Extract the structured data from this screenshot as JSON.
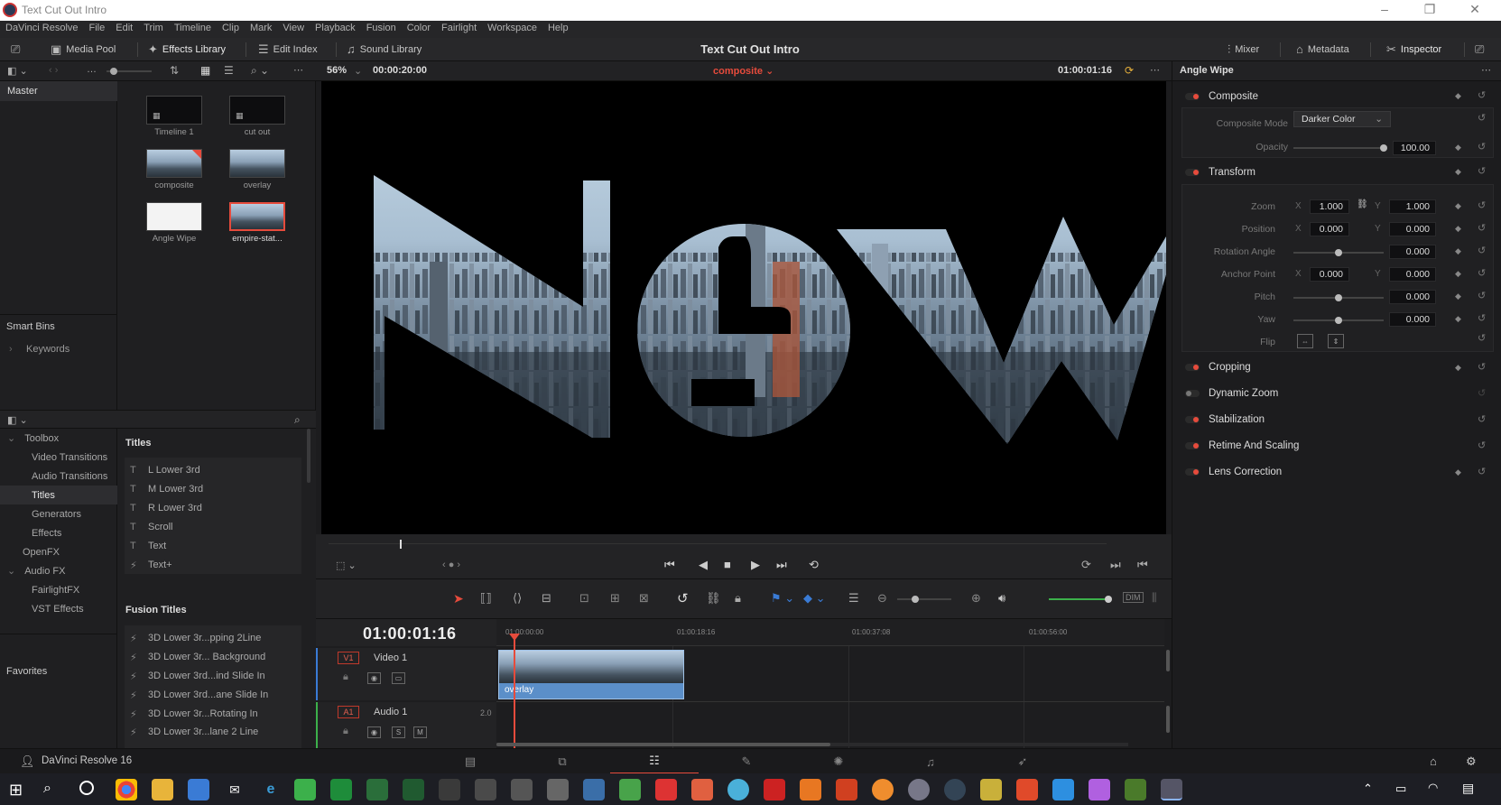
{
  "window": {
    "title": "Text Cut Out Intro"
  },
  "menu": [
    "DaVinci Resolve",
    "File",
    "Edit",
    "Trim",
    "Timeline",
    "Clip",
    "Mark",
    "View",
    "Playback",
    "Fusion",
    "Color",
    "Fairlight",
    "Workspace",
    "Help"
  ],
  "toolbar": {
    "media_pool": "Media Pool",
    "effects_library": "Effects Library",
    "edit_index": "Edit Index",
    "sound_library": "Sound Library",
    "project_title": "Text Cut Out Intro",
    "mixer": "Mixer",
    "metadata": "Metadata",
    "inspector": "Inspector"
  },
  "subbar": {
    "zoom": "56%",
    "duration": "00:00:20:00",
    "timeline_name": "composite",
    "timecode": "01:00:01:16",
    "inspector_title": "Angle Wipe"
  },
  "bins": {
    "master": "Master",
    "smart_bins": "Smart Bins",
    "keywords": "Keywords",
    "favorites": "Favorites"
  },
  "media": [
    {
      "label": "Timeline 1"
    },
    {
      "label": "cut out"
    },
    {
      "label": "composite"
    },
    {
      "label": "overlay"
    },
    {
      "label": "Angle Wipe"
    },
    {
      "label": "empire-stat..."
    }
  ],
  "toolbox": {
    "root": "Toolbox",
    "items": [
      "Video Transitions",
      "Audio Transitions",
      "Titles",
      "Generators",
      "Effects"
    ],
    "openfx": "OpenFX",
    "audiofx": "Audio FX",
    "audio_items": [
      "FairlightFX",
      "VST Effects"
    ]
  },
  "titles": {
    "header": "Titles",
    "items": [
      "L Lower 3rd",
      "M Lower 3rd",
      "R Lower 3rd",
      "Scroll",
      "Text",
      "Text+"
    ]
  },
  "fusion_titles": {
    "header": "Fusion Titles",
    "items": [
      "3D Lower 3r...pping 2Line",
      "3D Lower 3r... Background",
      "3D Lower 3rd...ind Slide In",
      "3D Lower 3rd...ane Slide In",
      "3D Lower 3r...Rotating In",
      "3D Lower 3r...lane 2 Line"
    ]
  },
  "viewer": {
    "text": "New"
  },
  "timeline": {
    "timecode": "01:00:01:16",
    "ruler": [
      "01:00:00:00",
      "01:00:18:16",
      "01:00:37:08",
      "01:00:56:00"
    ],
    "video_track": {
      "id": "V1",
      "name": "Video 1",
      "clip": "overlay"
    },
    "audio_track": {
      "id": "A1",
      "name": "Audio 1",
      "channels": "2.0",
      "solo": "S",
      "mute": "M"
    }
  },
  "inspector": {
    "composite": {
      "label": "Composite",
      "mode_label": "Composite Mode",
      "mode_value": "Darker Color",
      "opacity_label": "Opacity",
      "opacity_value": "100.00"
    },
    "transform": {
      "label": "Transform",
      "zoom_label": "Zoom",
      "zoom_x": "1.000",
      "zoom_y": "1.000",
      "position_label": "Position",
      "pos_x": "0.000",
      "pos_y": "0.000",
      "rotation_label": "Rotation Angle",
      "rotation": "0.000",
      "anchor_label": "Anchor Point",
      "anchor_x": "0.000",
      "anchor_y": "0.000",
      "pitch_label": "Pitch",
      "pitch": "0.000",
      "yaw_label": "Yaw",
      "yaw": "0.000",
      "flip_label": "Flip",
      "x": "X",
      "y": "Y"
    },
    "cropping": "Cropping",
    "dynamic_zoom": "Dynamic Zoom",
    "stabilization": "Stabilization",
    "retime": "Retime And Scaling",
    "lens": "Lens Correction"
  },
  "pagebar": {
    "app": "DaVinci Resolve 16"
  },
  "colors": {
    "accent": "#e64b3c",
    "clip": "#5b8fc9",
    "bg": "#1c1c1e"
  }
}
